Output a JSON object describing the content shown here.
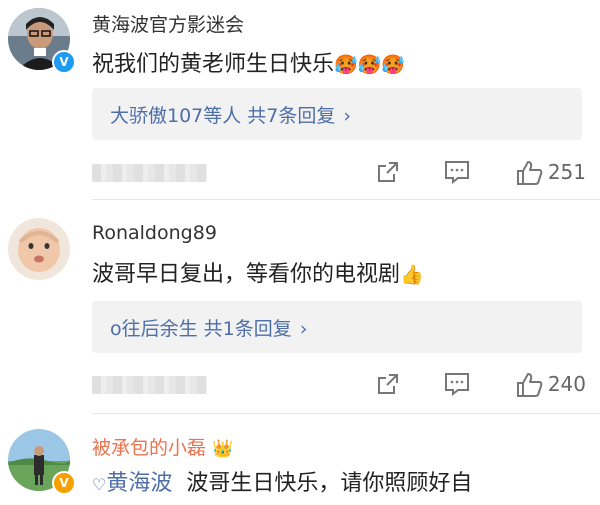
{
  "comments": [
    {
      "username": "黄海波官方影迷会",
      "content": "祝我们的黄老师生日快乐",
      "emojis": "🥵🥵🥵",
      "reply_summary": "大骄傲107等人 共7条回复",
      "likes": "251",
      "badge": "V",
      "badge_color": "#1d9bf0"
    },
    {
      "username": "Ronaldong89",
      "content": "波哥早日复出，等看你的电视剧",
      "emojis": "👍",
      "reply_summary": "o往后余生 共1条回复",
      "likes": "240"
    },
    {
      "username": "被承包的小磊",
      "username_color": "#eb7350",
      "crown": "👑",
      "mention": "黄海波",
      "content": "波哥生日快乐，请你照顾好自",
      "badge": "V",
      "badge_color": "#f6a000"
    }
  ],
  "icons": [
    "share-icon",
    "comment-icon",
    "like-icon",
    "chevron-right-icon"
  ]
}
